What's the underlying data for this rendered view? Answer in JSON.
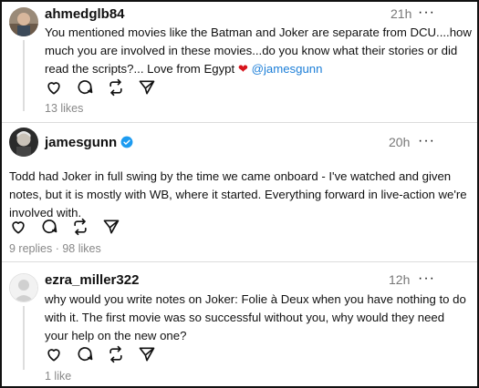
{
  "posts": [
    {
      "username": "ahmedglb84",
      "time": "21h",
      "text_main": "You mentioned movies like the Batman and Joker are separate from DCU....how much you are involved in these movies...do you know what their stories or did read the scripts?... Love from Egypt ",
      "heart": "❤",
      "mention": "@jamesgunn",
      "stats": "13 likes",
      "more": "···"
    },
    {
      "username": "jamesgunn",
      "time": "20h",
      "text": "Todd had Joker in full swing by the time we came onboard - I've watched and given notes, but it is mostly with WB, where it started. Everything forward in live-action we're involved with.",
      "stats": "9 replies · 98 likes",
      "more": "···"
    },
    {
      "username": "ezra_miller322",
      "time": "12h",
      "text": "why would you write notes on Joker: Folie à Deux when you have nothing to do with it. The first movie was so successful without you, why would they need your help on the new one?",
      "stats": "1 like",
      "more": "···"
    }
  ],
  "icons": [
    "heart-icon",
    "comment-icon",
    "repost-icon",
    "share-icon",
    "verified-badge-icon",
    "more-icon"
  ],
  "colors": {
    "mention": "#1d7fd8",
    "verified": "#1d9bf0",
    "heart": "#d7141c",
    "muted": "#777777"
  }
}
